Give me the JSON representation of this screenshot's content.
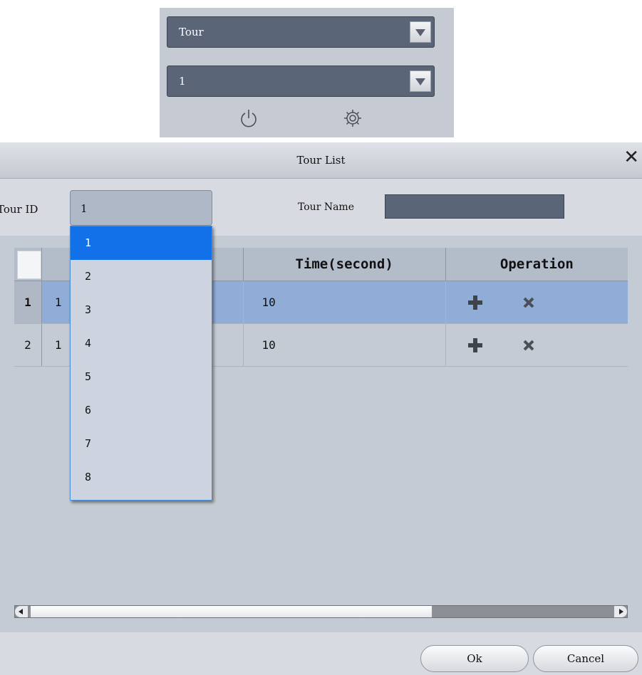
{
  "top_panel": {
    "mode_select": "Tour",
    "number_select": "1",
    "icons": [
      "power-icon",
      "gear-icon"
    ]
  },
  "dialog": {
    "title": "Tour List",
    "tour_id_label": "Tour ID",
    "tour_id_value": "1",
    "tour_name_label": "Tour Name",
    "tour_name_value": "",
    "table": {
      "columns": [
        "",
        "Time(second)",
        "Operation"
      ],
      "rows": [
        {
          "num": "1",
          "id": "1",
          "time": "10",
          "selected": true
        },
        {
          "num": "2",
          "id": "1",
          "time": "10",
          "selected": false
        }
      ]
    },
    "dropdown_options": [
      "1",
      "2",
      "3",
      "4",
      "5",
      "6",
      "7",
      "8"
    ],
    "dropdown_selected": "1",
    "ok_label": "Ok",
    "cancel_label": "Cancel"
  },
  "colors": {
    "panel_bg": "#c6cbd3",
    "combo_bg": "#5a6578",
    "selected_row": "#8fadd6",
    "selected_option": "#1270e8"
  }
}
